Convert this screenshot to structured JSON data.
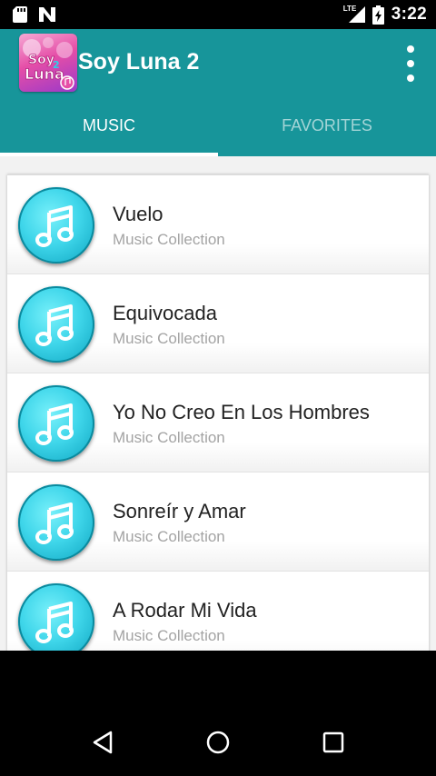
{
  "status_bar": {
    "network_label": "LTE",
    "time": "3:22"
  },
  "app_bar": {
    "title": "Soy Luna 2",
    "logo_text_top": "Soy",
    "logo_text_bottom": "Luna",
    "logo_number": "2",
    "color": "#17959a"
  },
  "tabs": [
    {
      "label": "MUSIC",
      "selected": true
    },
    {
      "label": "FAVORITES",
      "selected": false
    }
  ],
  "songs": [
    {
      "title": "Vuelo",
      "subtitle": "Music Collection",
      "icon": "music-note-icon"
    },
    {
      "title": "Equivocada",
      "subtitle": "Music Collection",
      "icon": "music-note-icon"
    },
    {
      "title": "Yo No Creo En Los Hombres",
      "subtitle": "Music Collection",
      "icon": "music-note-icon"
    },
    {
      "title": "Sonreír y Amar",
      "subtitle": "Music Collection",
      "icon": "music-note-icon"
    },
    {
      "title": "A Rodar Mi Vida",
      "subtitle": "Music Collection",
      "icon": "music-note-icon"
    }
  ],
  "nav_bar": {
    "icons": [
      "back-icon",
      "home-icon",
      "recents-icon"
    ]
  }
}
